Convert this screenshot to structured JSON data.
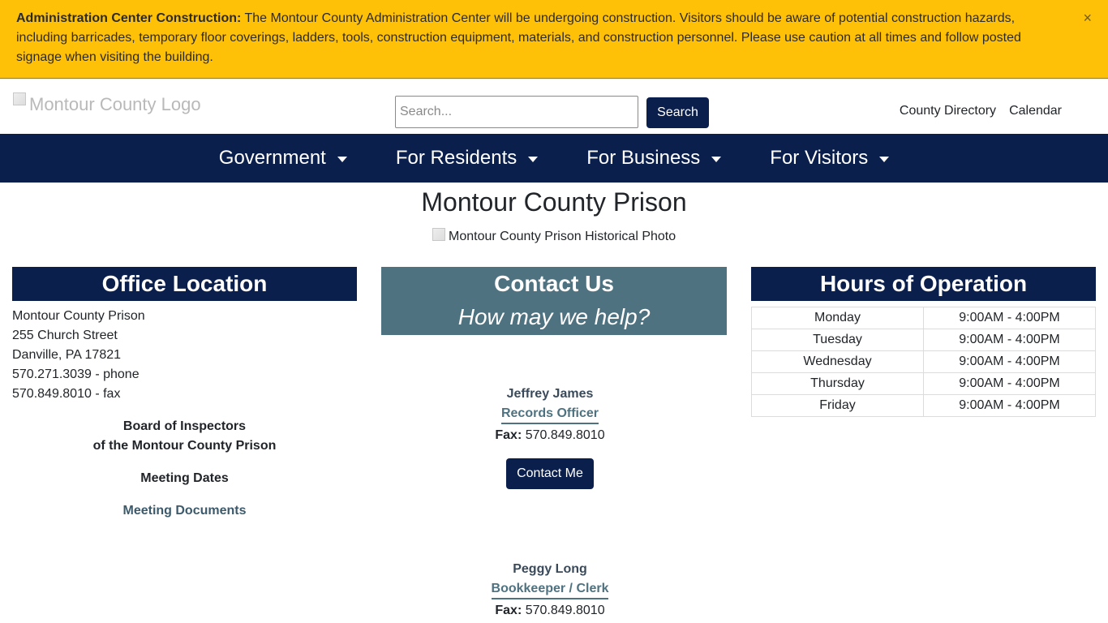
{
  "alert": {
    "title": "Administration Center Construction:",
    "message": " The Montour County Administration Center will be undergoing construction. Visitors should be aware of potential construction hazards, including barricades, temporary floor coverings, ladders, tools, construction equipment, materials, and construction personnel. Please use caution at all times and follow posted signage when visiting the building.",
    "close": "×"
  },
  "header": {
    "logo_alt": "Montour County Logo",
    "search_placeholder": "Search...",
    "search_value": "",
    "search_button": "Search",
    "links": [
      "County Directory",
      "Calendar"
    ]
  },
  "nav": {
    "items": [
      "Government",
      "For Residents",
      "For Business",
      "For Visitors"
    ]
  },
  "page": {
    "title": "Montour County Prison",
    "photo_alt": "Montour County Prison Historical Photo"
  },
  "office": {
    "heading": "Office Location",
    "lines": [
      "Montour County Prison",
      "255 Church Street",
      "Danville, PA  17821",
      "570.271.3039 - phone",
      "570.849.8010 - fax"
    ],
    "board_line1": "Board of Inspectors",
    "board_line2": "of the Montour County Prison",
    "meeting_dates": "Meeting Dates",
    "meeting_documents": "Meeting Documents"
  },
  "contact": {
    "heading": "Contact Us",
    "subheading": "How may we help?",
    "people": [
      {
        "name": "Jeffrey James",
        "role": "Records Officer",
        "fax_label": "Fax:",
        "fax": " 570.849.8010",
        "button": "Contact Me"
      },
      {
        "name": "Peggy Long",
        "role": "Bookkeeper / Clerk",
        "fax_label": "Fax:",
        "fax": " 570.849.8010"
      }
    ]
  },
  "hours": {
    "heading": "Hours of Operation",
    "rows": [
      {
        "day": "Monday",
        "time": "9:00AM - 4:00PM"
      },
      {
        "day": "Tuesday",
        "time": "9:00AM - 4:00PM"
      },
      {
        "day": "Wednesday",
        "time": "9:00AM - 4:00PM"
      },
      {
        "day": "Thursday",
        "time": "9:00AM - 4:00PM"
      },
      {
        "day": "Friday",
        "time": "9:00AM - 4:00PM"
      }
    ]
  },
  "colors": {
    "alert_bg": "#ffc107",
    "navy": "#0b1f4d",
    "teal": "#4f7280"
  }
}
